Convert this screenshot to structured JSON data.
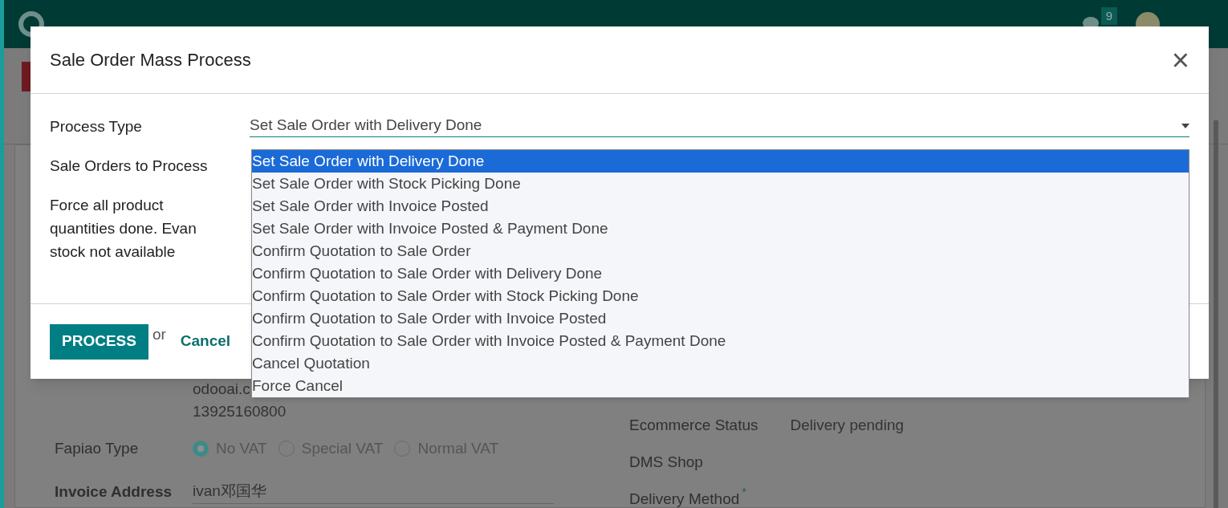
{
  "navbar": {
    "message_count": "9"
  },
  "form": {
    "left": [
      {
        "kind": "text",
        "value": "odooai.c"
      },
      {
        "kind": "text",
        "value": "13925160800"
      },
      {
        "kind": "radio",
        "label": "Fapiao Type",
        "options": [
          {
            "label": "No VAT",
            "selected": true
          },
          {
            "label": "Special VAT",
            "selected": false
          },
          {
            "label": "Normal VAT",
            "selected": false
          }
        ]
      },
      {
        "kind": "field",
        "label": "Invoice Address",
        "value": "ivan邓国华"
      }
    ],
    "right": [
      {
        "label": "Ecommerce Status",
        "value": "Delivery pending"
      },
      {
        "label": "DMS Shop"
      },
      {
        "label": "Delivery Method",
        "marker": "*"
      }
    ]
  },
  "dialog": {
    "title": "Sale Order Mass Process",
    "close": "×",
    "fields": [
      {
        "label": "Process Type",
        "value": "Set Sale Order with Delivery Done"
      },
      {
        "label": "Sale Orders to Process"
      },
      {
        "label": "Force all product quantities done. Evan stock not available"
      }
    ],
    "options": [
      {
        "label": "Set Sale Order with Delivery Done",
        "selected": true
      },
      {
        "label": "Set Sale Order with Stock Picking Done",
        "selected": false
      },
      {
        "label": "Set Sale Order with Invoice Posted",
        "selected": false
      },
      {
        "label": "Set Sale Order with Invoice Posted & Payment Done",
        "selected": false
      },
      {
        "label": "Confirm Quotation to Sale Order",
        "selected": false
      },
      {
        "label": "Confirm Quotation to Sale Order with Delivery Done",
        "selected": false
      },
      {
        "label": "Confirm Quotation to Sale Order with Stock Picking Done",
        "selected": false
      },
      {
        "label": "Confirm Quotation to Sale Order with Invoice Posted",
        "selected": false
      },
      {
        "label": "Confirm Quotation to Sale Order with Invoice Posted & Payment Done",
        "selected": false
      },
      {
        "label": "Cancel Quotation",
        "selected": false
      },
      {
        "label": "Force Cancel",
        "selected": false
      }
    ],
    "primary_button": "PROCESS",
    "or": "or",
    "cancel": "Cancel"
  }
}
